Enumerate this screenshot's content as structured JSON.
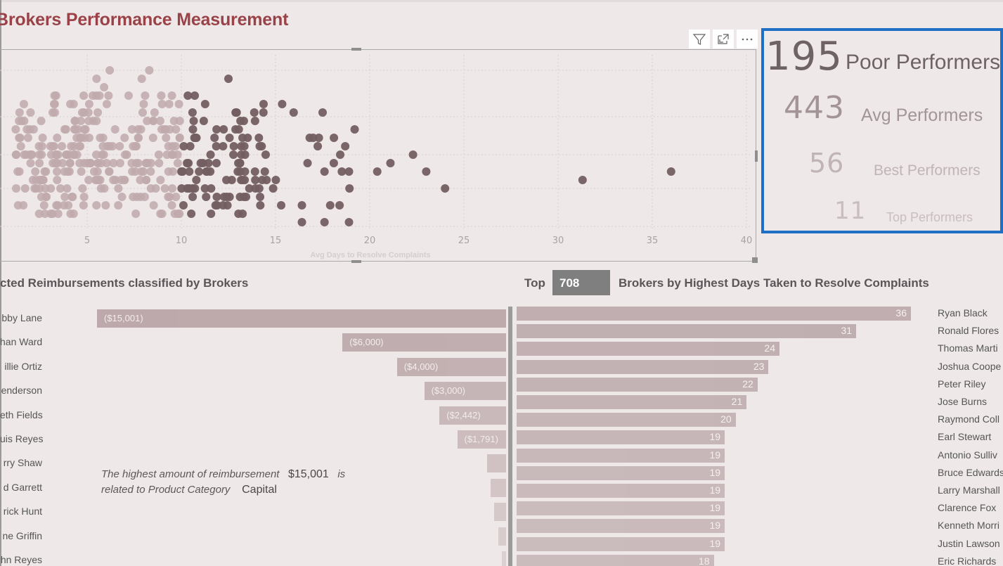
{
  "report": {
    "title": "Brokers Performance Measurement"
  },
  "toolbar": {
    "filter_icon": "filter-icon",
    "focus_icon": "focus-mode-icon",
    "more_icon": "more-options-icon"
  },
  "kpi_card": {
    "border_color": "#1e6fc5",
    "items": [
      {
        "value": "195",
        "label": "Poor Performers",
        "color": "#6e6264"
      },
      {
        "value": "443",
        "label": "Avg Performers",
        "color": "#a39597"
      },
      {
        "value": "56",
        "label": "Best Performers",
        "color": "#c1b4b6"
      },
      {
        "value": "11",
        "label": "Top Performers",
        "color": "#c9bdbf"
      }
    ]
  },
  "reimbursements": {
    "title": "cted Reimbursements classified by Brokers",
    "callout": {
      "prefix": "The highest amount of reimbursement",
      "amount": "$15,001",
      "mid": "is",
      "line2": "related to Product Category",
      "category": "Capital"
    }
  },
  "top_brokers": {
    "prefix": "Top",
    "topn_value": "708",
    "title": "Brokers by Highest Days Taken to Resolve Complaints"
  },
  "chart_data": [
    {
      "type": "scatter",
      "title": "",
      "xlabel": "Avg Days to Resolve Complaints",
      "ylabel": "",
      "xlim": [
        0,
        40
      ],
      "x_ticks": [
        "5",
        "10",
        "15",
        "20",
        "25",
        "30",
        "35",
        "40"
      ],
      "grid": true,
      "note": "Dense dot-strip scatter of brokers; points x<10 lighter shade, 10-20 darker shade. Notable outliers listed.",
      "colors": {
        "low": "#bfa9ab",
        "high": "#735e61"
      },
      "outliers": [
        {
          "x": 20.4,
          "row": 6
        },
        {
          "x": 21.1,
          "row": 5
        },
        {
          "x": 22.3,
          "row": 4
        },
        {
          "x": 23.0,
          "row": 6
        },
        {
          "x": 24.0,
          "row": 8
        },
        {
          "x": 31.3,
          "row": 7
        },
        {
          "x": 36.0,
          "row": 6
        }
      ]
    },
    {
      "type": "bar",
      "orientation": "horizontal-reversed",
      "title": "cted Reimbursements classified by Brokers",
      "categories": [
        "bby Lane",
        "han Ward",
        "illie Ortiz",
        "enderson",
        "eth Fields",
        "uis Reyes",
        "rry Shaw",
        "d Garrett",
        "rick Hunt",
        "ne Griffin",
        "hn Reyes"
      ],
      "values": [
        -15001,
        -6000,
        -4000,
        -3000,
        -2442,
        -1791,
        -700,
        -560,
        -430,
        -280,
        -120
      ],
      "labels": [
        "($15,001)",
        "($6,000)",
        "($4,000)",
        "($3,000)",
        "($2,442)",
        "($1,791)",
        "",
        "",
        "",
        "",
        ""
      ],
      "color": "#bba6a8"
    },
    {
      "type": "bar",
      "orientation": "horizontal",
      "title": "Brokers by Highest Days Taken to Resolve Complaints",
      "categories": [
        "Ryan Black",
        "Ronald Flores",
        "Thomas Marti",
        "Joshua Coope",
        "Peter Riley",
        "Jose Burns",
        "Raymond Coll",
        "Earl Stewart",
        "Antonio Sulliv",
        "Bruce Edwards",
        "Larry Marshall",
        "Clarence Fox",
        "Kenneth Morri",
        "Justin Lawson",
        "Eric Richards"
      ],
      "values": [
        36,
        31,
        24,
        23,
        22,
        21,
        20,
        19,
        19,
        19,
        19,
        19,
        19,
        19,
        18
      ],
      "color": "#c0aeb0"
    }
  ]
}
